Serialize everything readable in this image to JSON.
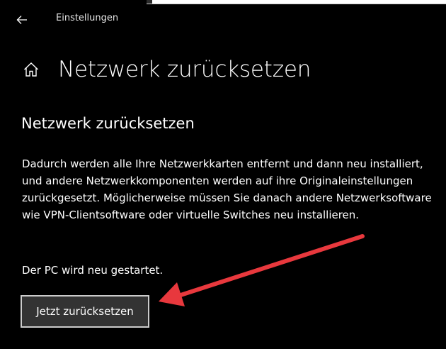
{
  "window": {
    "app_title": "Einstellungen",
    "back_icon": "back-arrow-icon"
  },
  "header": {
    "icon": "home-icon",
    "title": "Netzwerk zurücksetzen"
  },
  "section": {
    "title": "Netzwerk zurücksetzen",
    "description": "Dadurch werden alle Ihre Netzwerkkarten entfernt und dann neu installiert, und andere Netzwerkkomponenten werden auf ihre Originaleinstellungen zurückgesetzt. Möglicherweise müssen Sie danach andere Netzwerksoftware wie VPN-Clientsoftware oder virtuelle Switches neu installieren.",
    "restart_note": "Der PC wird neu gestartet.",
    "reset_button_label": "Jetzt zurücksetzen"
  },
  "annotation": {
    "arrow_color": "#e8383d"
  },
  "colors": {
    "background": "#000000",
    "text": "#ffffff",
    "button_background": "#333333",
    "button_border": "#cccccc"
  }
}
